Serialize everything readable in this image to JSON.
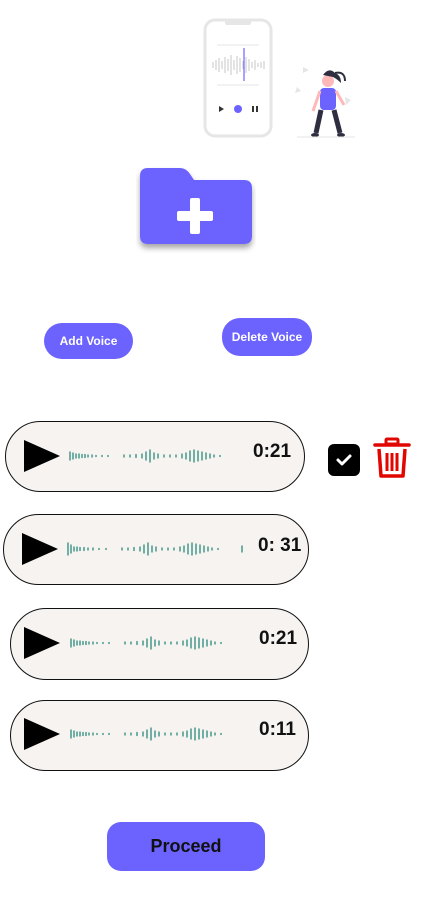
{
  "header": {
    "illustration_icon": "voice-recording-illustration"
  },
  "folder": {
    "icon": "folder-add-icon"
  },
  "actions": {
    "add_voice_label": "Add Voice",
    "delete_voice_label": "Delete Voice"
  },
  "recordings": [
    {
      "duration": "0:21",
      "selected": true
    },
    {
      "duration": "0: 31",
      "selected": false
    },
    {
      "duration": "0:21",
      "selected": false
    },
    {
      "duration": "0:11",
      "selected": false
    }
  ],
  "footer": {
    "proceed_label": "Proceed"
  },
  "colors": {
    "accent": "#6c63ff",
    "card_bg": "#f6f3f1",
    "wave": "#2a8a7a",
    "delete": "#e10600"
  }
}
